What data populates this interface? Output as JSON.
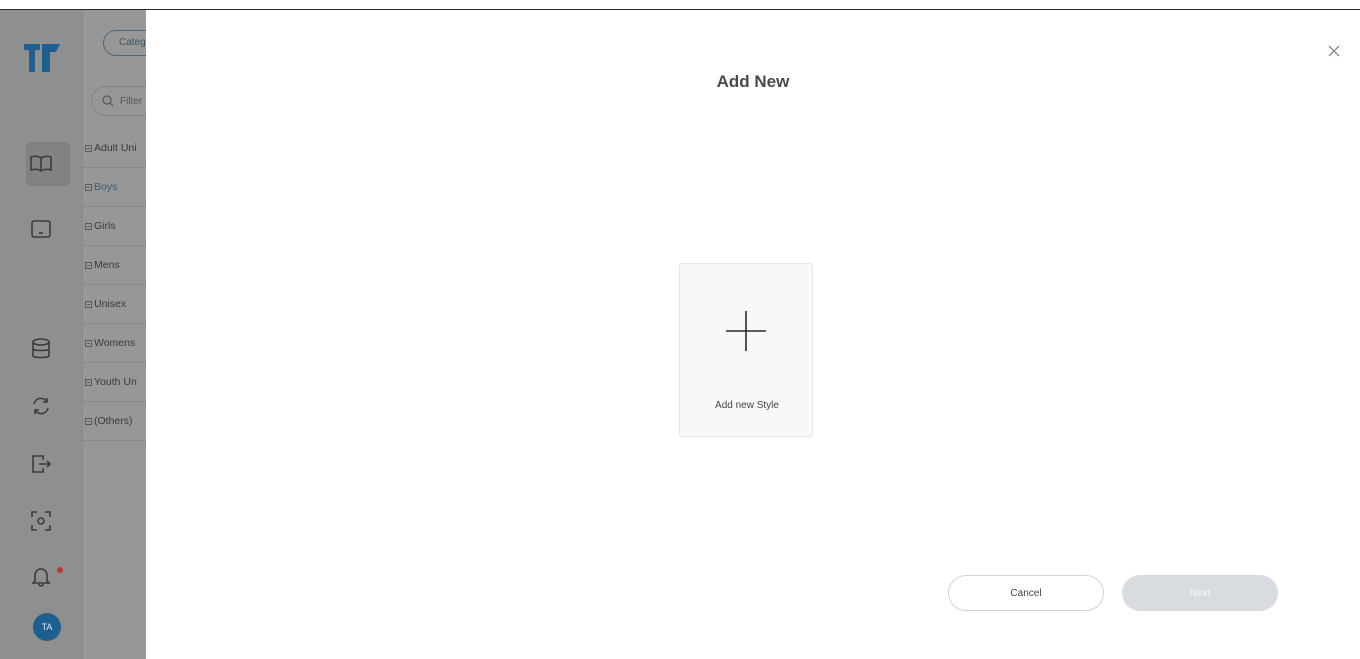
{
  "app": {
    "avatar_initials": "TA",
    "accent_color": "#1d5f8f"
  },
  "sidebar": {
    "icons": [
      "book-icon",
      "tablet-icon",
      "database-icon",
      "sync-icon",
      "export-icon",
      "scan-icon",
      "bell-icon"
    ]
  },
  "categories": {
    "pill_label": "Categ",
    "filter_placeholder": "Filter",
    "items": [
      "Adult Uni",
      "Boys",
      "Girls",
      "Mens",
      "Unisex",
      "Womens",
      "Youth Un",
      "(Others)"
    ]
  },
  "modal": {
    "title": "Add New",
    "card_label": "Add new Style",
    "cancel_label": "Cancel",
    "next_label": "Next"
  }
}
